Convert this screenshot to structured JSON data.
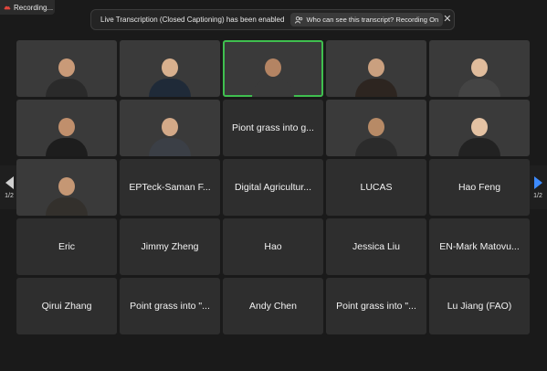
{
  "recording": {
    "label": "Recording..."
  },
  "banner": {
    "message": "Live Transcription (Closed Captioning) has been enabled",
    "pill_label": "Who can see this transcript? Recording On",
    "close_glyph": "✕"
  },
  "nav": {
    "left_page": "1/2",
    "right_page": "1/2"
  },
  "tiles": [
    {
      "name": "",
      "video": true,
      "bg": "bg-office"
    },
    {
      "name": "",
      "video": true,
      "bg": "bg-white"
    },
    {
      "name": "",
      "video": true,
      "bg": "bg-grey",
      "active": true
    },
    {
      "name": "",
      "video": true,
      "bg": "bg-cream"
    },
    {
      "name": "",
      "video": true,
      "bg": "bg-teal"
    },
    {
      "name": "",
      "video": true,
      "bg": "bg-warm"
    },
    {
      "name": "",
      "video": true,
      "bg": "bg-wall"
    },
    {
      "name": "Piont grass into g...",
      "video": false
    },
    {
      "name": "",
      "video": true,
      "bg": "bg-shelf"
    },
    {
      "name": "",
      "video": true,
      "bg": "bg-car"
    },
    {
      "name": "",
      "video": true,
      "bg": "bg-room"
    },
    {
      "name": "EPTeck-Saman F...",
      "video": false
    },
    {
      "name": "Digital Agricultur...",
      "video": false
    },
    {
      "name": "LUCAS",
      "video": false
    },
    {
      "name": "Hao Feng",
      "video": false
    },
    {
      "name": "Eric",
      "video": false
    },
    {
      "name": "Jimmy Zheng",
      "video": false
    },
    {
      "name": "Hao",
      "video": false
    },
    {
      "name": "Jessica Liu",
      "video": false
    },
    {
      "name": "EN-Mark Matovu...",
      "video": false
    },
    {
      "name": "Qirui Zhang",
      "video": false
    },
    {
      "name": "Point grass into \"...",
      "video": false
    },
    {
      "name": "Andy Chen",
      "video": false
    },
    {
      "name": "Point grass into \"...",
      "video": false
    },
    {
      "name": "Lu Jiang (FAO)",
      "video": false
    }
  ],
  "colors": {
    "active_speaker": "#3fbf4f",
    "accent": "#3d8bff",
    "recording": "#e0463c"
  }
}
